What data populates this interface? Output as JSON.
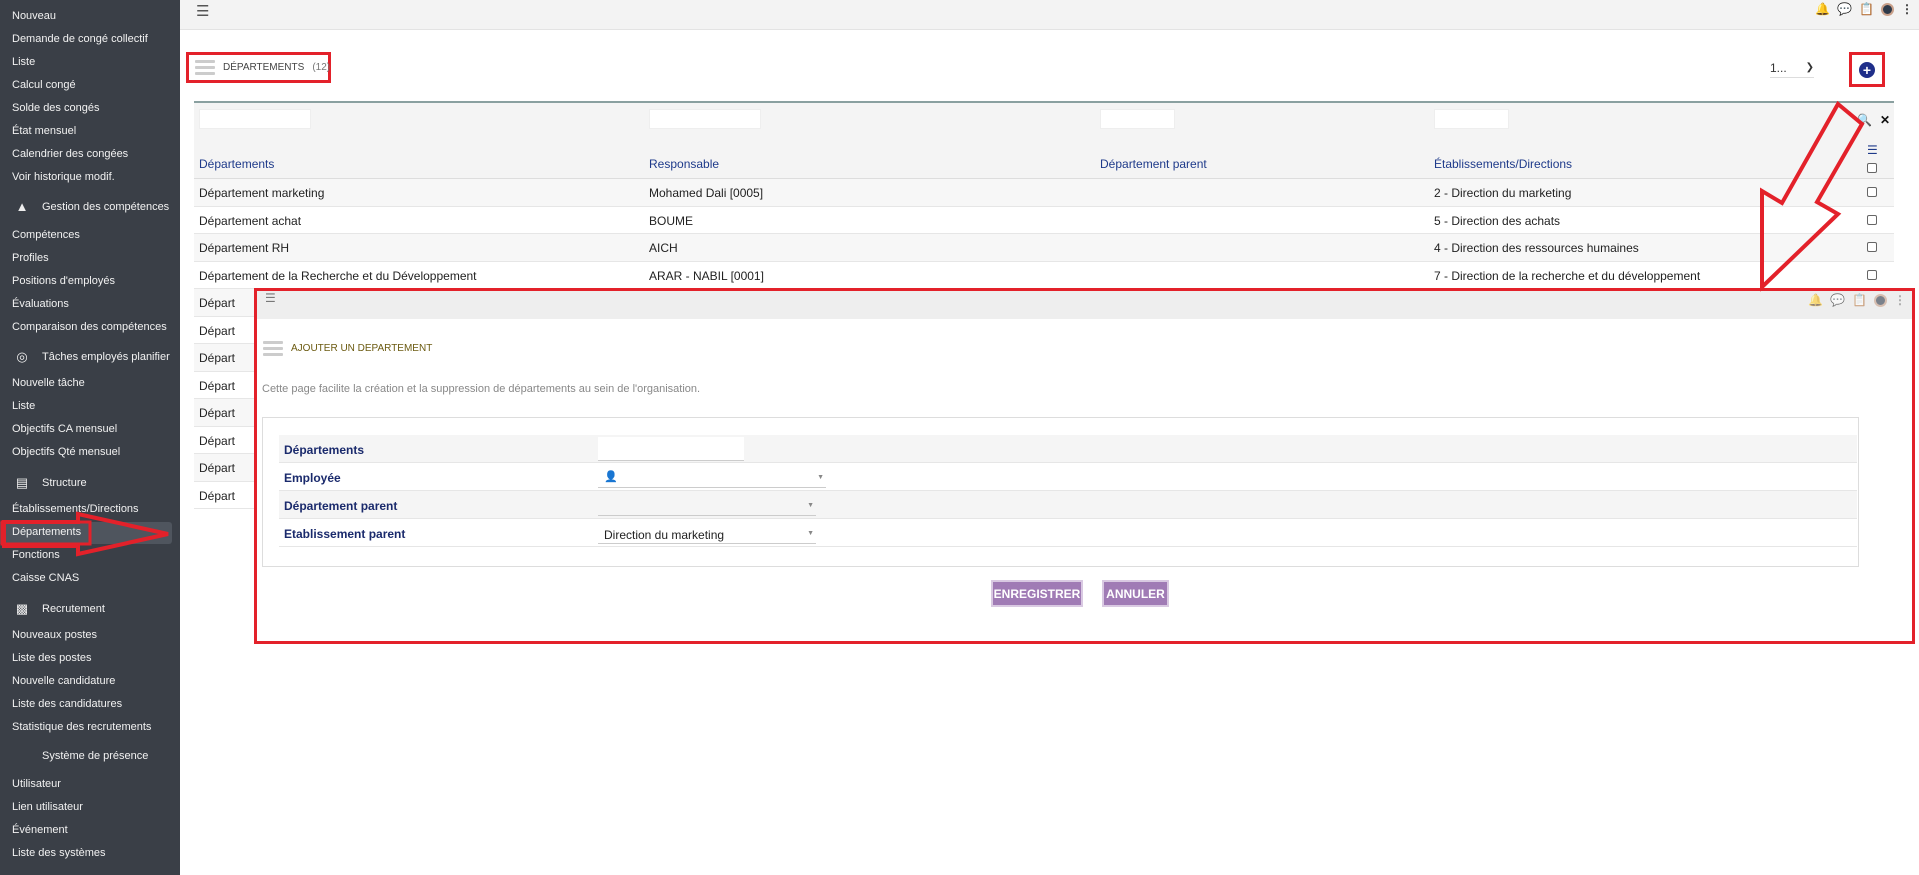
{
  "sidebar": {
    "items": [
      {
        "label": "Nouveau"
      },
      {
        "label": "Demande de congé collectif"
      },
      {
        "label": "Liste"
      },
      {
        "label": "Calcul congé"
      },
      {
        "label": "Solde des congés"
      },
      {
        "label": "État mensuel"
      },
      {
        "label": "Calendrier des congées"
      },
      {
        "label": "Voir historique modif."
      },
      {
        "label": "Gestion des compétences",
        "icon": "shapes-icon",
        "section": true
      },
      {
        "label": "Compétences"
      },
      {
        "label": "Profiles"
      },
      {
        "label": "Positions d'employés"
      },
      {
        "label": "Évaluations"
      },
      {
        "label": "Comparaison des compétences"
      },
      {
        "label": "Tâches employés planifier",
        "icon": "target-icon",
        "section": true
      },
      {
        "label": "Nouvelle tâche"
      },
      {
        "label": "Liste"
      },
      {
        "label": "Objectifs CA mensuel"
      },
      {
        "label": "Objectifs Qté mensuel"
      },
      {
        "label": "Structure",
        "icon": "building-icon",
        "section": true
      },
      {
        "label": "Établissements/Directions"
      },
      {
        "label": "Départements",
        "active": true
      },
      {
        "label": "Fonctions"
      },
      {
        "label": "Caisse CNAS"
      },
      {
        "label": "Recrutement",
        "icon": "id-badge-icon",
        "section": true
      },
      {
        "label": "Nouveaux postes"
      },
      {
        "label": "Liste des postes"
      },
      {
        "label": "Nouvelle candidature"
      },
      {
        "label": "Liste des candidatures"
      },
      {
        "label": "Statistique des recrutements"
      },
      {
        "label": "Système de présence",
        "icon": "",
        "section": true
      },
      {
        "label": "Utilisateur"
      },
      {
        "label": "Lien utilisateur"
      },
      {
        "label": "Événement"
      },
      {
        "label": "Liste des systèmes"
      }
    ]
  },
  "header": {
    "title": "DÉPARTEMENTS",
    "count": "(12)",
    "pager_value": "1...",
    "icons": [
      "bell-icon",
      "chat-icon",
      "clipboard-icon",
      "avatar",
      "more-vertical-icon"
    ]
  },
  "table": {
    "columns": [
      "Départements",
      "Responsable",
      "Département parent",
      "Établissements/Directions"
    ],
    "rows": [
      [
        "Département marketing",
        "Mohamed   Dali   [0005]",
        "",
        "2 - Direction du marketing"
      ],
      [
        "Département achat",
        "BOUME",
        "",
        "5 - Direction des achats"
      ],
      [
        "Département RH",
        "AICH",
        "",
        "4 - Direction des ressources humaines"
      ],
      [
        "Département de la Recherche et du Développement",
        "ARAR - NABIL [0001]",
        "",
        "7 - Direction de la recherche et du développement"
      ],
      [
        "Départ",
        "",
        "",
        ""
      ],
      [
        "Départ",
        "",
        "",
        ""
      ],
      [
        "Départ",
        "",
        "",
        ""
      ],
      [
        "Départ",
        "",
        "",
        ""
      ],
      [
        "Départ",
        "",
        "",
        ""
      ],
      [
        "Départ",
        "",
        "",
        ""
      ],
      [
        "Départ",
        "",
        "",
        ""
      ],
      [
        "Départ",
        "",
        "",
        ""
      ]
    ]
  },
  "overlay": {
    "title": "AJOUTER UN DEPARTEMENT",
    "description": "Cette page facilite la création et la suppression de départements au sein de l'organisation.",
    "fields": [
      {
        "label": "Départements",
        "value": "",
        "type": "text"
      },
      {
        "label": "Employée",
        "value": "",
        "type": "select-user"
      },
      {
        "label": "Département parent",
        "value": "",
        "type": "select"
      },
      {
        "label": "Etablissement parent",
        "value": "Direction du marketing",
        "type": "select"
      }
    ],
    "save_label": "ENREGISTRER",
    "cancel_label": "ANNULER"
  },
  "colors": {
    "sidebar_bg": "#3a3f47",
    "annotation_red": "#e3212a",
    "link_blue": "#1e3a8a",
    "button_purple": "#a07bb5",
    "add_button": "#1f2f8a"
  }
}
